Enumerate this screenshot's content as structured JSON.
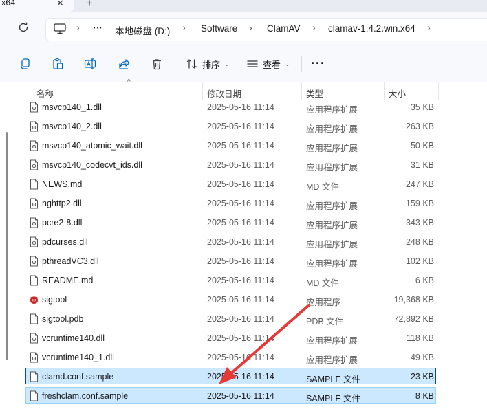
{
  "tab": {
    "title": "x64",
    "close": "✕",
    "new_tab": "+"
  },
  "address": {
    "more": "⋯",
    "crumbs": [
      "本地磁盘 (D:)",
      "Software",
      "ClamAV",
      "clamav-1.4.2.win.x64"
    ],
    "separator": "›"
  },
  "commands": {
    "sort_label": "排序",
    "view_label": "查看",
    "more": "···"
  },
  "columns": {
    "name": "名称",
    "date": "修改日期",
    "type": "类型",
    "size": "大小"
  },
  "files": [
    {
      "name": "msvcp140_1.dll",
      "date": "2025-05-16 11:14",
      "type": "应用程序扩展",
      "size": "35 KB",
      "icon": "dll-file-icon"
    },
    {
      "name": "msvcp140_2.dll",
      "date": "2025-05-16 11:14",
      "type": "应用程序扩展",
      "size": "263 KB",
      "icon": "dll-file-icon"
    },
    {
      "name": "msvcp140_atomic_wait.dll",
      "date": "2025-05-16 11:14",
      "type": "应用程序扩展",
      "size": "50 KB",
      "icon": "dll-file-icon"
    },
    {
      "name": "msvcp140_codecvt_ids.dll",
      "date": "2025-05-16 11:14",
      "type": "应用程序扩展",
      "size": "31 KB",
      "icon": "dll-file-icon"
    },
    {
      "name": "NEWS.md",
      "date": "2025-05-16 11:14",
      "type": "MD 文件",
      "size": "247 KB",
      "icon": "blank-file-icon"
    },
    {
      "name": "nghttp2.dll",
      "date": "2025-05-16 11:14",
      "type": "应用程序扩展",
      "size": "159 KB",
      "icon": "dll-file-icon"
    },
    {
      "name": "pcre2-8.dll",
      "date": "2025-05-16 11:14",
      "type": "应用程序扩展",
      "size": "343 KB",
      "icon": "dll-file-icon"
    },
    {
      "name": "pdcurses.dll",
      "date": "2025-05-16 11:14",
      "type": "应用程序扩展",
      "size": "248 KB",
      "icon": "dll-file-icon"
    },
    {
      "name": "pthreadVC3.dll",
      "date": "2025-05-16 11:14",
      "type": "应用程序扩展",
      "size": "102 KB",
      "icon": "dll-file-icon"
    },
    {
      "name": "README.md",
      "date": "2025-05-16 11:14",
      "type": "MD 文件",
      "size": "6 KB",
      "icon": "blank-file-icon"
    },
    {
      "name": "sigtool",
      "date": "2025-05-16 11:14",
      "type": "应用程序",
      "size": "19,368 KB",
      "icon": "clamav-app-icon"
    },
    {
      "name": "sigtool.pdb",
      "date": "2025-05-16 11:14",
      "type": "PDB 文件",
      "size": "72,892 KB",
      "icon": "blank-file-icon"
    },
    {
      "name": "vcruntime140.dll",
      "date": "2025-05-16 11:14",
      "type": "应用程序扩展",
      "size": "118 KB",
      "icon": "dll-file-icon"
    },
    {
      "name": "vcruntime140_1.dll",
      "date": "2025-05-16 11:14",
      "type": "应用程序扩展",
      "size": "49 KB",
      "icon": "dll-file-icon"
    },
    {
      "name": "clamd.conf.sample",
      "date": "2025-05-16 11:14",
      "type": "SAMPLE 文件",
      "size": "23 KB",
      "icon": "blank-file-icon",
      "selected": true
    },
    {
      "name": "freshclam.conf.sample",
      "date": "2025-05-16 11:14",
      "type": "SAMPLE 文件",
      "size": "8 KB",
      "icon": "blank-file-icon",
      "selected": true
    }
  ],
  "annotation": {
    "color": "#e53935"
  },
  "colors": {
    "selection": "#cce8ff",
    "selection_border": "#0e4f7a",
    "accent": "#0067c0"
  }
}
